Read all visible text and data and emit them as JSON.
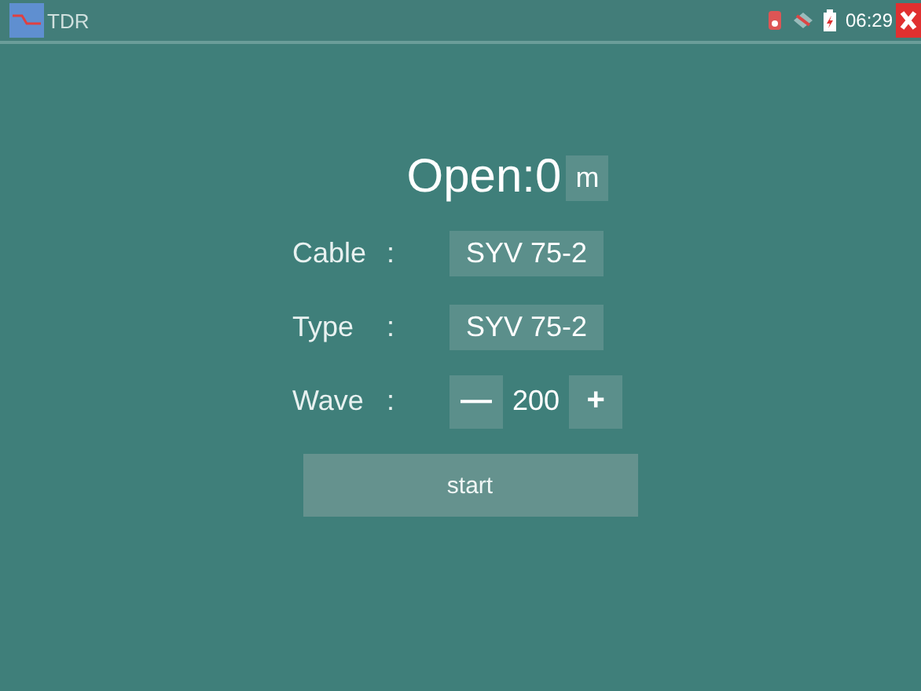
{
  "app_bar": {
    "title": "TDR",
    "time": "06:29"
  },
  "result": {
    "text": "Open:0",
    "unit": "m"
  },
  "settings": [
    {
      "kind": "select",
      "label": "Cable",
      "separator": ":",
      "value": "SYV 75-2"
    },
    {
      "kind": "select",
      "label": "Type",
      "separator": ":",
      "value": "SYV 75-2"
    },
    {
      "kind": "stepper",
      "label": "Wave",
      "separator": ":",
      "decrement": "—",
      "value": "200",
      "increment": "+"
    }
  ],
  "start_button": "start"
}
